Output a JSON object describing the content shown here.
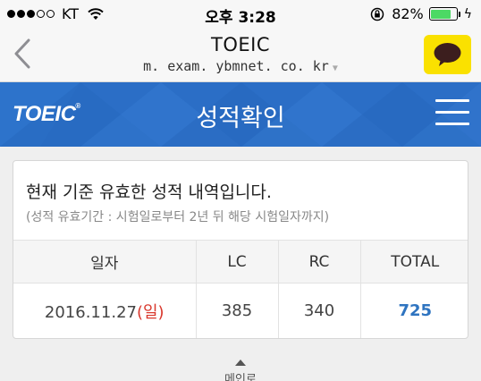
{
  "status_bar": {
    "carrier": "KT",
    "time": "오후 3:28",
    "battery_percent": "82%",
    "battery_level": 0.82,
    "battery_color": "#4cd964"
  },
  "browser": {
    "title": "TOEIC",
    "url": "m. exam. ybmnet. co. kr",
    "back_icon": "chevron-left-icon",
    "share_icon": "kakao-talk-icon"
  },
  "header": {
    "logo": "TOEIC",
    "title": "성적확인",
    "menu_icon": "hamburger-menu-icon",
    "brand_color": "#2b6ec6"
  },
  "score_card": {
    "heading": "현재 기준 유효한 성적 내역입니다.",
    "note": "(성적 유효기간 : 시험일로부터 2년 뒤 해당 시험일자까지)",
    "columns": [
      "일자",
      "LC",
      "RC",
      "TOTAL"
    ],
    "rows": [
      {
        "date": "2016.11.27",
        "day": "(일)",
        "lc": "385",
        "rc": "340",
        "total": "725"
      }
    ]
  },
  "footer": {
    "main_link": "메인로"
  }
}
